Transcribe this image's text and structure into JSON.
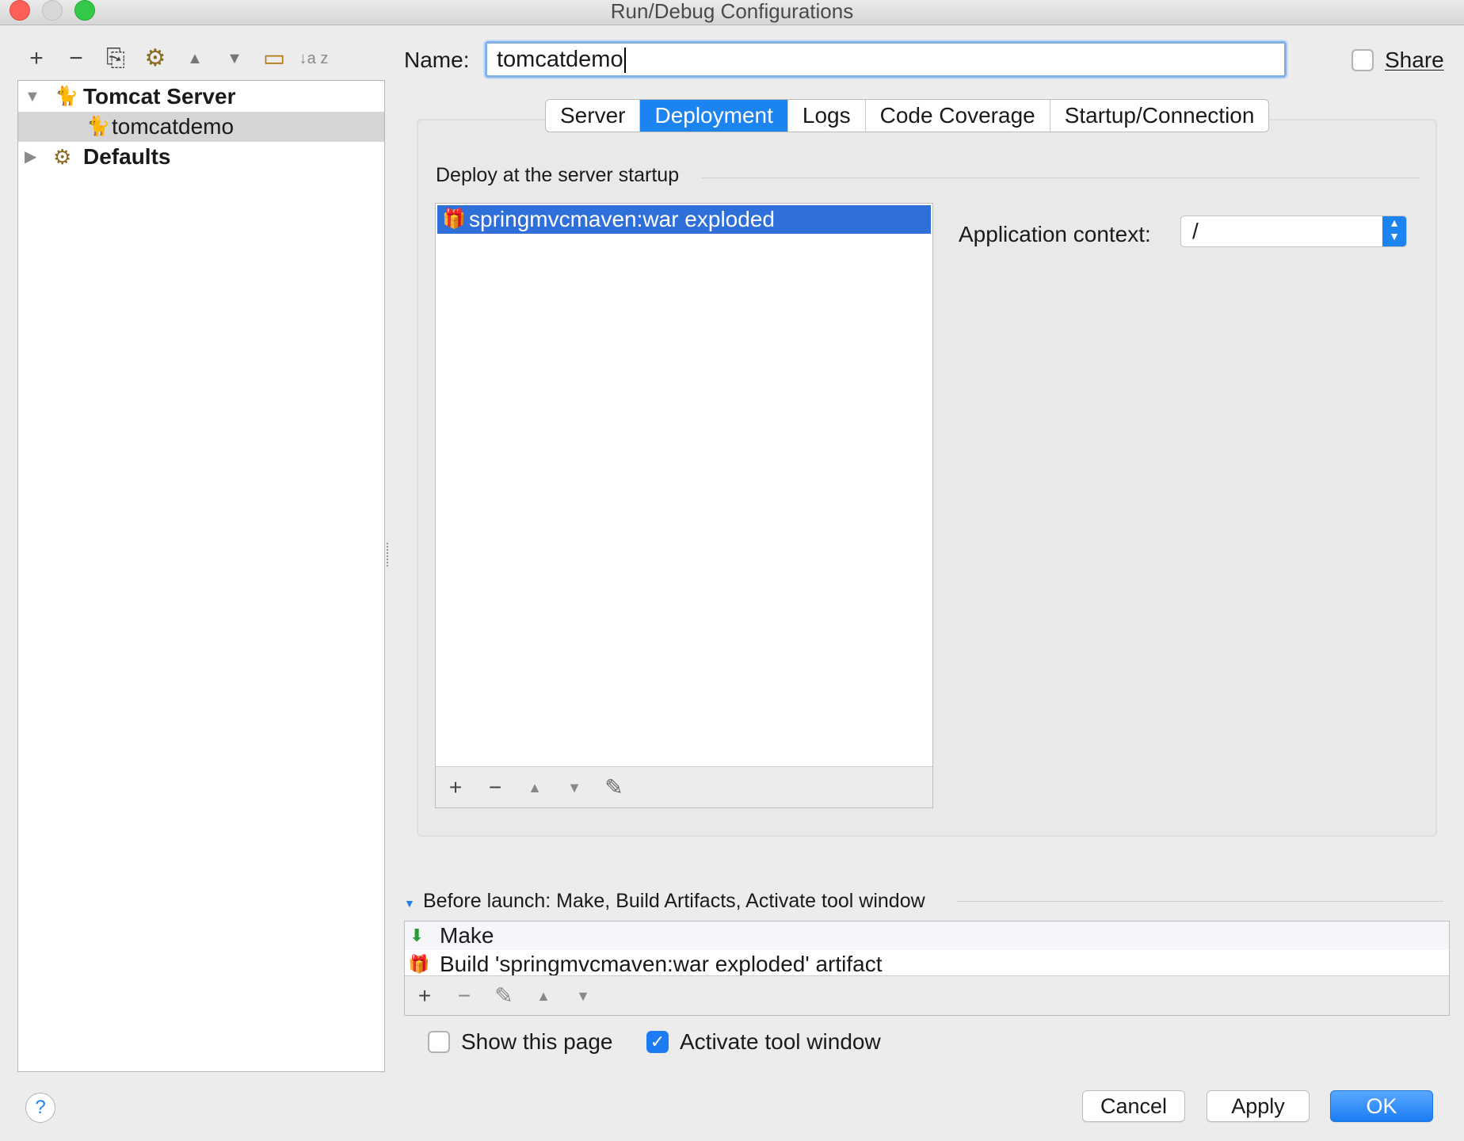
{
  "window": {
    "title": "Run/Debug Configurations"
  },
  "toolbar": {
    "add": "+",
    "remove": "−",
    "copy": "⎘",
    "edit_defaults": "⚙",
    "move_up": "▲",
    "move_down": "▼",
    "folder": "▭",
    "sort": "↓a z"
  },
  "tree": {
    "items": [
      {
        "label": "Tomcat Server",
        "expanded": true
      },
      {
        "label": "tomcatdemo",
        "selected": true
      },
      {
        "label": "Defaults",
        "expanded": false
      }
    ]
  },
  "name_field": {
    "label": "Name:",
    "value": "tomcatdemo"
  },
  "share": {
    "label": "Share",
    "checked": false
  },
  "tabs": [
    "Server",
    "Deployment",
    "Logs",
    "Code Coverage",
    "Startup/Connection"
  ],
  "active_tab": "Deployment",
  "deployment": {
    "section_title": "Deploy at the server startup",
    "items": [
      "springmvcmaven:war exploded"
    ],
    "app_context_label": "Application context:",
    "app_context_value": "/"
  },
  "before_launch": {
    "title": "Before launch: Make, Build Artifacts, Activate tool window",
    "items": [
      "Make",
      "Build 'springmvcmaven:war exploded' artifact"
    ]
  },
  "options": {
    "show_page": {
      "label": "Show this page",
      "checked": false
    },
    "activate_tool_window": {
      "label": "Activate tool window",
      "checked": true
    }
  },
  "buttons": {
    "help": "?",
    "cancel": "Cancel",
    "apply": "Apply",
    "ok": "OK"
  },
  "colors": {
    "accent": "#1b84f1",
    "selection": "#2f6fd9"
  }
}
